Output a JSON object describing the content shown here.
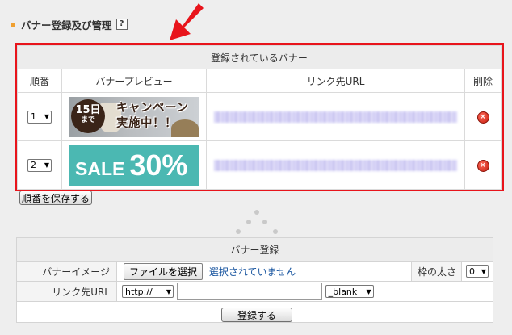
{
  "section": {
    "title": "バナー登録及び管理",
    "help_label": "?"
  },
  "banner_list": {
    "title": "登録されているバナー",
    "columns": {
      "order": "順番",
      "preview": "バナープレビュー",
      "url": "リンク先URL",
      "delete": "削除"
    },
    "rows": [
      {
        "order": "1",
        "thumb": {
          "date_big": "15日",
          "date_small": "まで",
          "line1": "キャンペーン",
          "line2": "実施中！！"
        }
      },
      {
        "order": "2",
        "thumb": {
          "word": "SALE",
          "percent": "30%"
        }
      }
    ]
  },
  "save_order_label": "順番を保存する",
  "register": {
    "title": "バナー登録",
    "image_label": "バナーイメージ",
    "file_button": "ファイルを選択",
    "file_status": "選択されていません",
    "border_label": "枠の太さ",
    "border_value": "0",
    "url_label": "リンク先URL",
    "protocol_value": "http://",
    "target_value": "_blank",
    "submit_label": "登録する"
  },
  "colors": {
    "highlight": "#e8141b",
    "thumb_teal": "#4bb8b2",
    "link_blue": "#1a56a0"
  }
}
